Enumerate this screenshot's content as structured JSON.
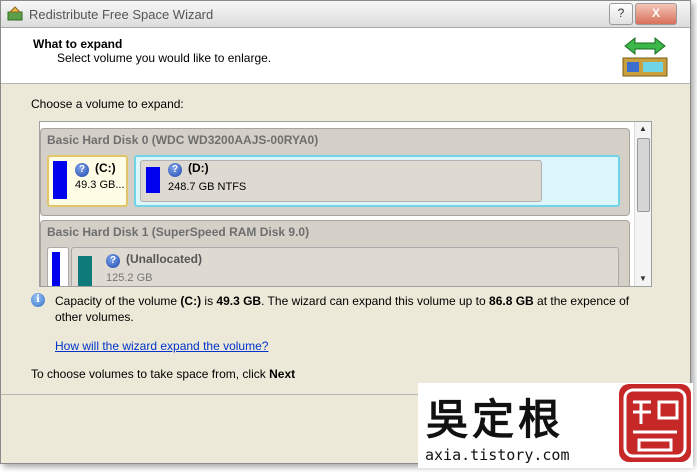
{
  "window": {
    "title": "Redistribute Free Space Wizard",
    "help_btn": "?",
    "close_btn": "X"
  },
  "header": {
    "title": "What to expand",
    "subtitle": "Select volume you would like to enlarge."
  },
  "choose_label": "Choose a volume to expand:",
  "disks": [
    {
      "title": "Basic Hard Disk 0 (WDC WD3200AAJS-00RYA0)",
      "partitions": [
        {
          "label": "(C:)",
          "info": "49.3 GB...",
          "color": "#0000ee",
          "fill": 1.0
        },
        {
          "label": "(D:)",
          "info": "248.7 GB NTFS",
          "color": "#0000ee",
          "fill": 1.0
        }
      ]
    },
    {
      "title": "Basic Hard Disk 1 (SuperSpeed RAM Disk 9.0)",
      "partitions": [
        {
          "label": "",
          "info": "",
          "color": "#0000ee"
        },
        {
          "label": "(Unallocated)",
          "info": "125.2 GB",
          "color": "#0f7a7a"
        }
      ]
    }
  ],
  "capacity": {
    "p1": "Capacity of the volume ",
    "vol": "(C:)",
    "p2": " is ",
    "size": "49.3 GB",
    "p3": ". The wizard can expand this volume up to ",
    "max": "86.8 GB",
    "p4": " at the expence of other volumes."
  },
  "link": "How will the wizard expand the volume?",
  "footer": {
    "p1": "To choose volumes to take space from, click ",
    "next": "Next"
  },
  "watermark": {
    "chars": "吳定根",
    "url": "axia.tistory.com"
  },
  "colors": {
    "window_bg": "#ece9d8",
    "selected_c_border": "#e2c76a",
    "selected_d_border": "#6fd4e6",
    "link": "#0033cc",
    "info_blue": "#2d6fc9",
    "seal_red": "#c62828"
  }
}
